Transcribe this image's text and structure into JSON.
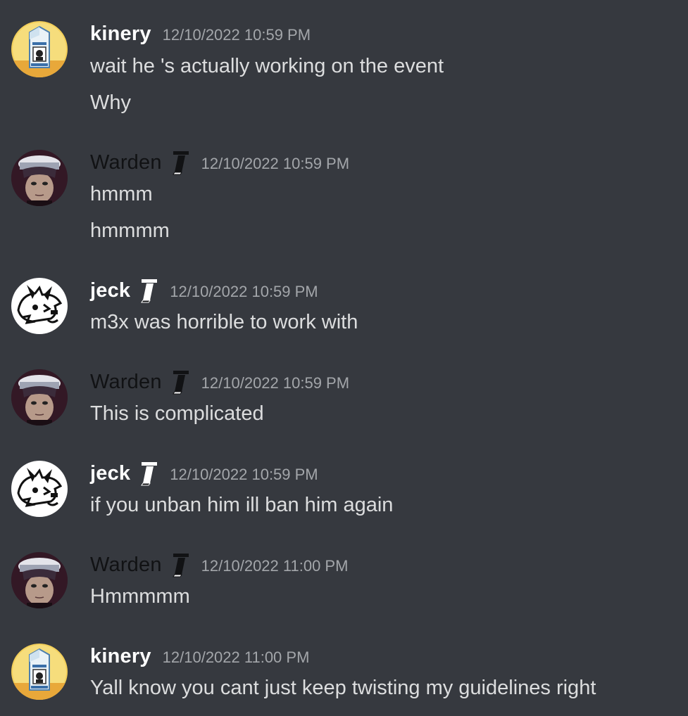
{
  "colors": {
    "background": "#36393f",
    "username": "#ffffff",
    "username_dark": "#111214",
    "timestamp": "#a3a6aa",
    "text": "#dcddde"
  },
  "messages": [
    {
      "username": "kinery",
      "avatar": "milk-carton-avatar",
      "badge": null,
      "timestamp": "12/10/2022 10:59 PM",
      "lines": [
        "wait he 's actually working on the event",
        "Why"
      ]
    },
    {
      "username": "Warden",
      "avatar": "anime-character-avatar",
      "badge": "tool-badge-icon",
      "timestamp": "12/10/2022 10:59 PM",
      "lines": [
        "hmmm",
        "hmmmm"
      ]
    },
    {
      "username": "jeck",
      "avatar": "cartoon-dog-avatar",
      "badge": "tool-badge-icon",
      "timestamp": "12/10/2022 10:59 PM",
      "lines": [
        "m3x was horrible to work with"
      ]
    },
    {
      "username": "Warden",
      "avatar": "anime-character-avatar",
      "badge": "tool-badge-icon",
      "timestamp": "12/10/2022 10:59 PM",
      "lines": [
        "This is complicated"
      ]
    },
    {
      "username": "jeck",
      "avatar": "cartoon-dog-avatar",
      "badge": "tool-badge-icon",
      "timestamp": "12/10/2022 10:59 PM",
      "lines": [
        "if you unban him ill ban him again"
      ]
    },
    {
      "username": "Warden",
      "avatar": "anime-character-avatar",
      "badge": "tool-badge-icon",
      "timestamp": "12/10/2022 11:00 PM",
      "lines": [
        "Hmmmmm"
      ]
    },
    {
      "username": "kinery",
      "avatar": "milk-carton-avatar",
      "badge": null,
      "timestamp": "12/10/2022 11:00 PM",
      "lines": [
        "Yall know you cant just keep twisting my guidelines right"
      ]
    }
  ]
}
